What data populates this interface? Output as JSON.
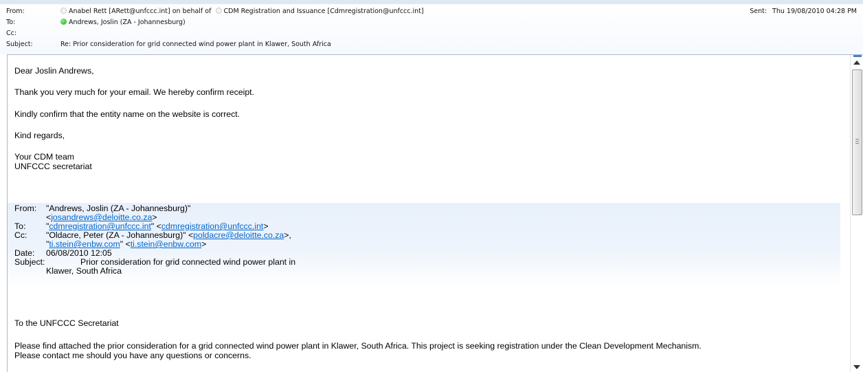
{
  "header": {
    "from_label": "From:",
    "from_sender": "Anabel Rett [ARett@unfccc.int] on behalf of",
    "from_onbehalf": "CDM Registration and Issuance [Cdmregistration@unfccc.int]",
    "to_label": "To:",
    "to_value": "Andrews, Joslin (ZA - Johannesburg)",
    "cc_label": "Cc:",
    "cc_value": "",
    "subject_label": "Subject:",
    "subject_value": "Re: Prior consideration for grid connected wind power plant in Klawer, South Africa",
    "sent_label": "Sent:",
    "sent_value": "Thu 19/08/2010 04:28 PM"
  },
  "reply": {
    "greeting": "Dear Joslin Andrews,",
    "line1": "Thank you very much for your email.  We hereby confirm receipt.",
    "line2": "Kindly confirm that the entity name on the website is correct.",
    "closing": "Kind regards,",
    "signature1": "Your CDM team",
    "signature2": "UNFCCC secretariat"
  },
  "quoted": {
    "from_label": "From:",
    "from_name": "\"Andrews, Joslin (ZA - Johannesburg)\"",
    "from_email": "josandrews@deloitte.co.za",
    "to_label": "To:",
    "to_name_link": "cdmregistration@unfccc.int",
    "to_email": "cdmregistration@unfccc.int",
    "cc_label": "Cc:",
    "cc1_name": "\"Oldacre, Peter (ZA - Johannesburg)\"",
    "cc1_email": "poldacre@deloitte.co.za",
    "cc2_name_link": "ti.stein@enbw.com",
    "cc2_email": "ti.stein@enbw.com",
    "date_label": "Date:",
    "date_value": "06/08/2010 12:05",
    "subject_label": "Subject:",
    "subject_line1": "Prior consideration for grid connected wind power plant in",
    "subject_line2": "Klawer, South Africa"
  },
  "original": {
    "salutation": "To the UNFCCC Secretariat",
    "para1": "Please find attached the prior consideration for a grid connected wind power plant in Klawer, South Africa. This project is seeking registration under the Clean Development Mechanism.",
    "para2": "Please contact me should you have any questions or concerns."
  },
  "colors": {
    "link": "#0066cc",
    "presence_online": "#1aa51a",
    "quote_background": "#e8f0fb"
  }
}
